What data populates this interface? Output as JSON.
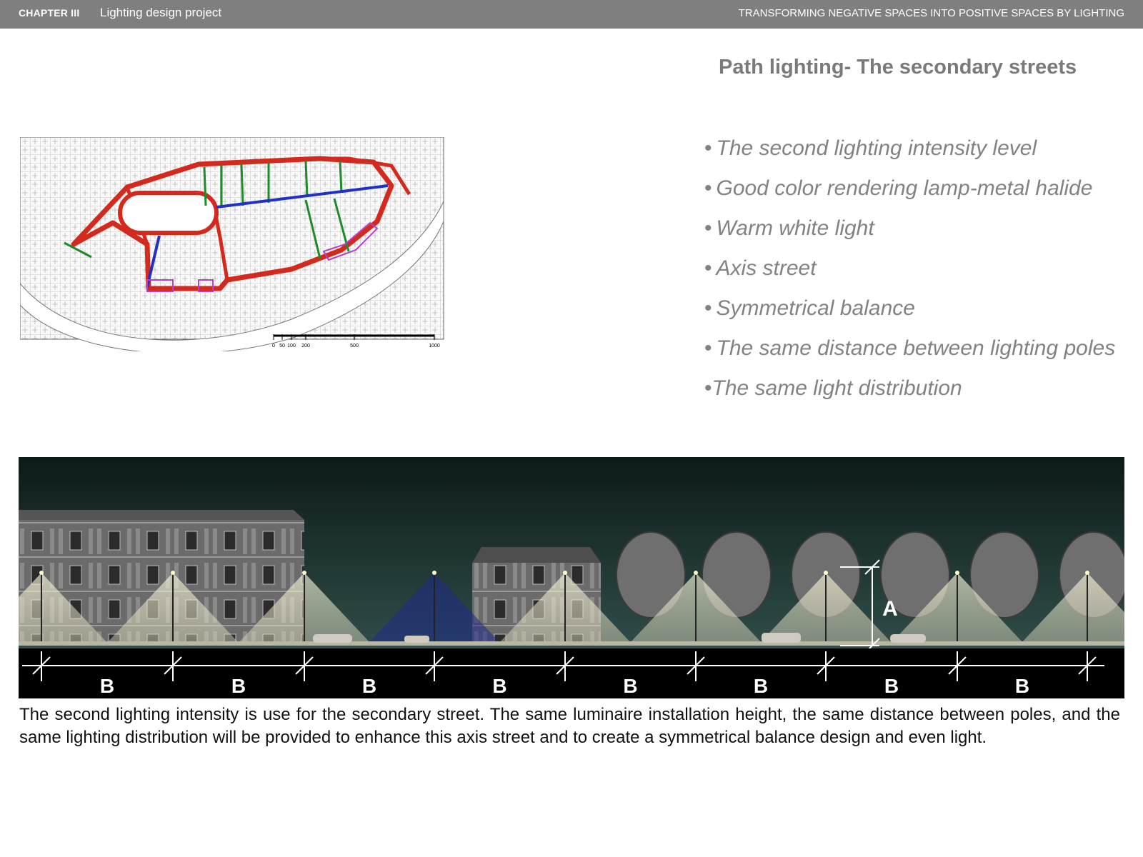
{
  "header": {
    "chapter": "CHAPTER III",
    "project": "Lighting design project",
    "subject": "TRANSFORMING NEGATIVE SPACES INTO POSITIVE SPACES BY LIGHTING"
  },
  "title": "Path lighting- The secondary streets",
  "bullets": [
    {
      "marker": "•",
      "text": "The second lighting intensity level"
    },
    {
      "marker": "•",
      "text": "Good color rendering lamp-metal halide"
    },
    {
      "marker": "•",
      "text": "Warm white light"
    },
    {
      "marker": "•",
      "text": "Axis street"
    },
    {
      "marker": "•",
      "text": "Symmetrical balance"
    },
    {
      "marker": "•",
      "text": "The same distance between lighting poles"
    },
    {
      "marker": "•",
      "text": "The same light distribution"
    }
  ],
  "map": {
    "scale_labels": [
      "0",
      "50",
      "100",
      "200",
      "500",
      "1000"
    ],
    "colors": {
      "main_route": "#d42a1e",
      "secondary": "#1f8a2a",
      "axis": "#2130c8",
      "highlight": "#b640c8"
    }
  },
  "section": {
    "height_label": "A",
    "spacing_labels": [
      "B",
      "B",
      "B",
      "B",
      "B",
      "B",
      "B",
      "B"
    ]
  },
  "caption": "The second lighting intensity is use for the secondary street. The same luminaire installation height, the same distance between poles, and the same lighting distribution will be provided to enhance this axis street and to create a symmetrical balance design and even light."
}
